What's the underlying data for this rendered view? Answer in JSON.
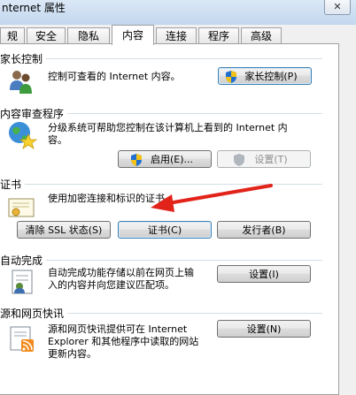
{
  "window": {
    "title": "nternet 属性",
    "close_glyph": "✕"
  },
  "tabs": [
    "规",
    "安全",
    "隐私",
    "内容",
    "连接",
    "程序",
    "高级"
  ],
  "family": {
    "header": "家长控制",
    "desc": "控制可查看的 Internet 内容。",
    "button": "家长控制(P)"
  },
  "advisor": {
    "header": "内容审查程序",
    "desc_line1": "分级系统可帮助您控制在该计算机上看到的 Internet 内",
    "desc_line2": "容。",
    "enable_button": "启用(E)...",
    "settings_button": "设置(T)"
  },
  "certs": {
    "header": "证书",
    "desc": "使用加密连接和标识的证书。",
    "clear_ssl_button": "清除 SSL 状态(S)",
    "certs_button": "证书(C)",
    "publishers_button": "发行者(B)"
  },
  "autocomplete": {
    "header": "自动完成",
    "desc_line1": "自动完成功能存储以前在网页上输",
    "desc_line2": "入的内容并向您建议匹配项。",
    "settings_button": "设置(I)"
  },
  "feeds": {
    "header": "源和网页快讯",
    "desc_line1": "源和网页快讯提供可在 Internet",
    "desc_line2": "Explorer 和其他程序中读取的网站",
    "desc_line3": "更新内容。",
    "settings_button": "设置(N)"
  },
  "colors": {
    "annotation_arrow": "#e2231a",
    "accent": "#3c7fb1"
  }
}
